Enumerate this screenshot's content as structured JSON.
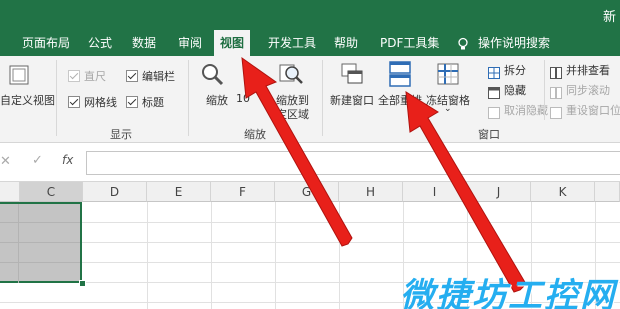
{
  "window": {
    "title_fragment": "新"
  },
  "tabs": [
    {
      "label": "页面布局"
    },
    {
      "label": "公式"
    },
    {
      "label": "数据"
    },
    {
      "label": "审阅"
    },
    {
      "label": "视图",
      "active": true
    },
    {
      "label": "开发工具"
    },
    {
      "label": "帮助"
    },
    {
      "label": "PDF工具集"
    },
    {
      "label": "操作说明搜索"
    }
  ],
  "ribbon": {
    "views_group": {
      "custom_view": "自定义视图"
    },
    "show_group": {
      "label": "显示",
      "ruler": {
        "label": "直尺",
        "checked": true,
        "disabled": true
      },
      "formula_bar": {
        "label": "编辑栏",
        "checked": true
      },
      "gridlines": {
        "label": "网格线",
        "checked": true
      },
      "headings": {
        "label": "标题",
        "checked": true
      }
    },
    "zoom_group": {
      "label": "缩放",
      "zoom": "缩放",
      "zoom_100": "10",
      "zoom_to_selection": "缩放到",
      "zoom_to_selection_2": "定区域"
    },
    "window_group": {
      "label": "窗口",
      "new_window": "新建窗口",
      "arrange_all": "全部重排",
      "freeze_panes": "冻结窗格",
      "split": "拆分",
      "hide": "隐藏",
      "unhide": "取消隐藏",
      "view_side_by_side": "并排查看",
      "synchronous_scrolling": "同步滚动",
      "reset_window_position": "重设窗口位"
    }
  },
  "formula_bar": {
    "fx": "fx",
    "cancel": "✕",
    "enter": "✓",
    "value": ""
  },
  "grid": {
    "columns": [
      "C",
      "D",
      "E",
      "F",
      "G",
      "H",
      "I",
      "J",
      "K"
    ]
  },
  "watermark": "微捷坊工控网",
  "colors": {
    "accent": "#217346",
    "arrow": "#e8201a",
    "watermark": "#25aef0"
  }
}
